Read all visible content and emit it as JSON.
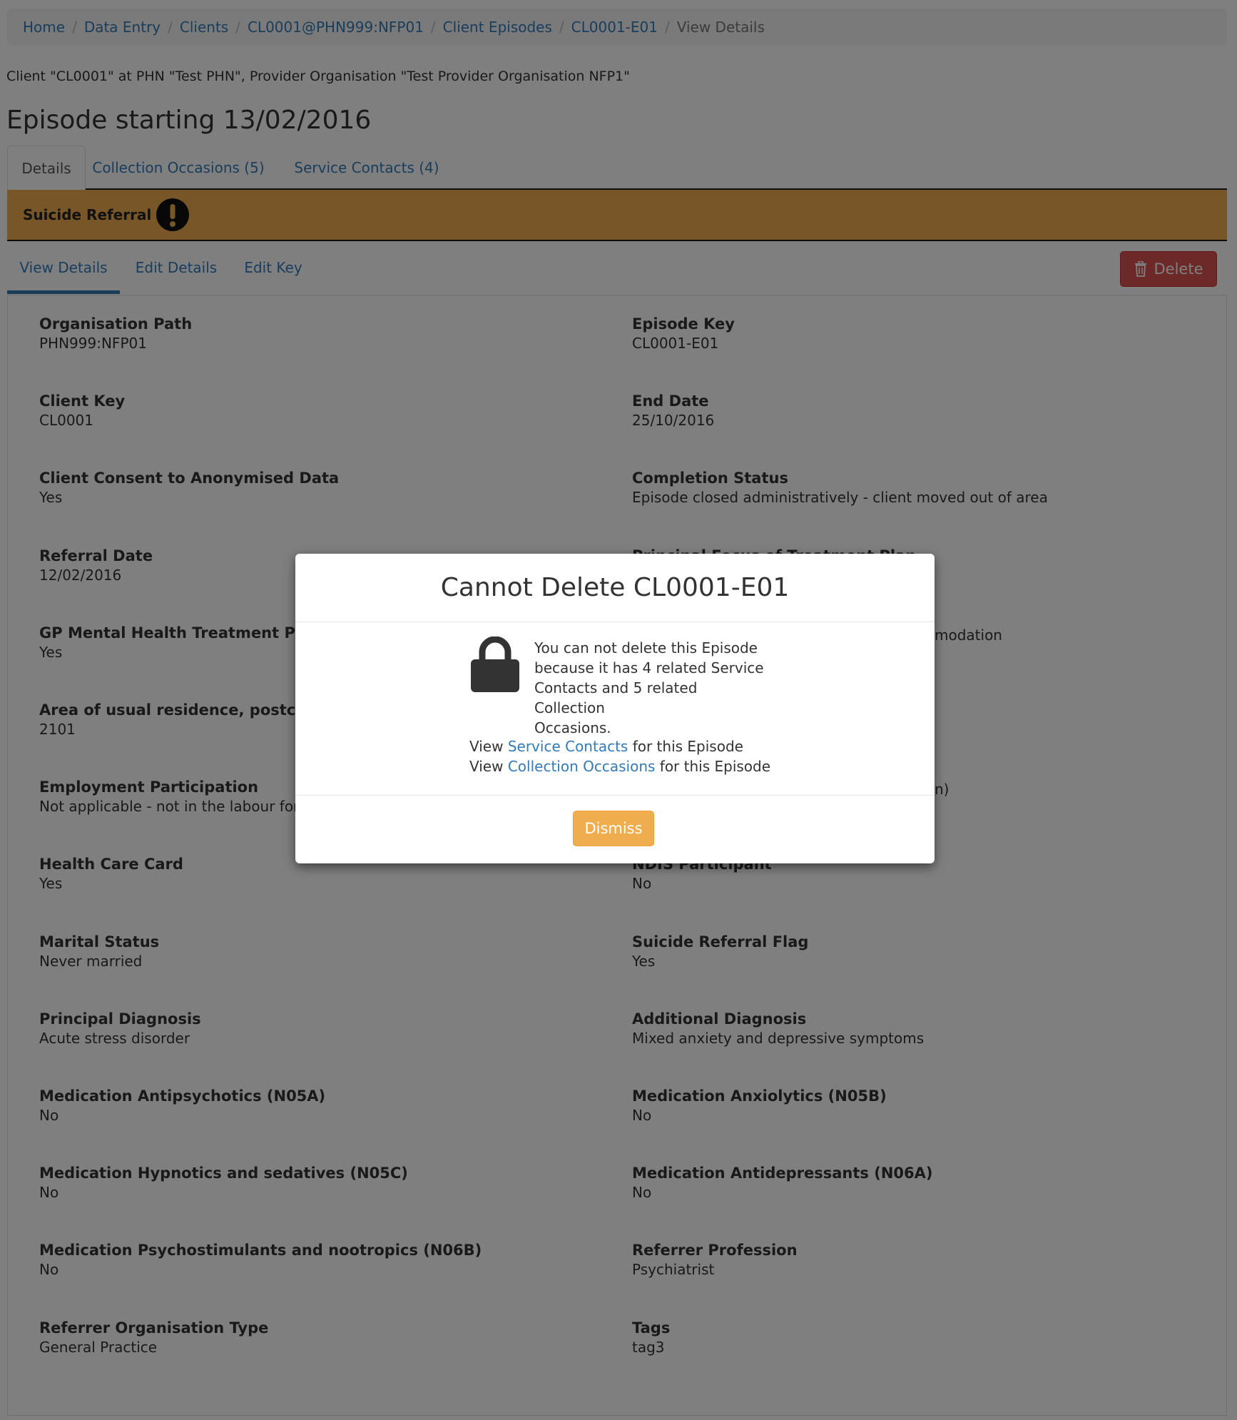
{
  "breadcrumb": {
    "items": [
      "Home",
      "Data Entry",
      "Clients",
      "CL0001@PHN999:NFP01",
      "Client Episodes",
      "CL0001-E01",
      "View Details"
    ]
  },
  "client_line": "Client \"CL0001\" at PHN \"Test PHN\", Provider Organisation \"Test Provider Organisation NFP1\"",
  "episode_title": "Episode starting 13/02/2016",
  "top_tabs": [
    "Details",
    "Collection Occasions (5)",
    "Service Contacts (4)"
  ],
  "alert": {
    "label": "Suicide Referral",
    "icon": "exclamation-circle-icon",
    "color": "#f0ad4e"
  },
  "sub_tabs": [
    "View Details",
    "Edit Details",
    "Edit Key"
  ],
  "delete_label": "Delete",
  "fields_left": [
    {
      "label": "Organisation Path",
      "value": "PHN999:NFP01"
    },
    {
      "label": "Client Key",
      "value": "CL0001"
    },
    {
      "label": "Client Consent to Anonymised Data",
      "value": "Yes"
    },
    {
      "label": "Referral Date",
      "value": "12/02/2016"
    },
    {
      "label": "GP Mental Health Treatment Plan",
      "value": "Yes"
    },
    {
      "label": "Area of usual residence, postcode",
      "value": "2101"
    },
    {
      "label": "Employment Participation",
      "value": "Not applicable - not in the labour force"
    },
    {
      "label": "Health Care Card",
      "value": "Yes"
    },
    {
      "label": "Marital Status",
      "value": "Never married"
    },
    {
      "label": "Principal Diagnosis",
      "value": "Acute stress disorder"
    },
    {
      "label": "Medication Antipsychotics (N05A)",
      "value": "No"
    },
    {
      "label": "Medication Hypnotics and sedatives (N05C)",
      "value": "No"
    },
    {
      "label": "Medication Psychostimulants and nootropics (N06B)",
      "value": "No"
    },
    {
      "label": "Referrer Organisation Type",
      "value": "General Practice"
    }
  ],
  "fields_right": [
    {
      "label": "Episode Key",
      "value": "CL0001-E01"
    },
    {
      "label": "End Date",
      "value": "25/10/2016"
    },
    {
      "label": "Completion Status",
      "value": "Episode closed administratively - client moved out of area"
    },
    {
      "label": "Principal Focus of Treatment Plan",
      "value": ""
    },
    {
      "label": "",
      "value": "modation"
    },
    {
      "label": "",
      "value": ""
    },
    {
      "label": "",
      "value": "n)"
    },
    {
      "label": "NDIS Participant",
      "value": "No"
    },
    {
      "label": "Suicide Referral Flag",
      "value": "Yes"
    },
    {
      "label": "Additional Diagnosis",
      "value": "Mixed anxiety and depressive symptoms"
    },
    {
      "label": "Medication Anxiolytics (N05B)",
      "value": "No"
    },
    {
      "label": "Medication Antidepressants (N06A)",
      "value": "No"
    },
    {
      "label": "Referrer Profession",
      "value": "Psychiatrist"
    },
    {
      "label": "Tags",
      "value": "tag3"
    }
  ],
  "modal": {
    "title": "Cannot Delete CL0001-E01",
    "icon": "lock-icon",
    "message_lines": [
      "You can not delete this Episode",
      "because it has 4 related Service",
      "Contacts and 5 related Collection",
      "Occasions."
    ],
    "link1": {
      "prefix": "View ",
      "link": "Service Contacts",
      "suffix": " for this Episode"
    },
    "link2": {
      "prefix": "View ",
      "link": "Collection Occasions",
      "suffix": " for this Episode"
    },
    "dismiss_label": "Dismiss"
  }
}
